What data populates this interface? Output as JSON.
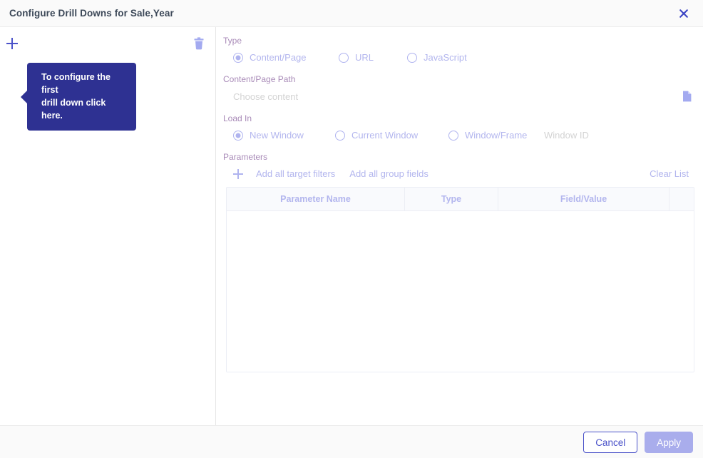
{
  "dialog": {
    "title": "Configure Drill Downs for Sale,Year",
    "close_icon": "close-icon"
  },
  "left_panel": {
    "add_icon": "plus-icon",
    "delete_icon": "trash-icon",
    "tooltip": {
      "line1": "To configure the first",
      "line2": "drill down click here."
    }
  },
  "type_section": {
    "label": "Type",
    "options": [
      {
        "label": "Content/Page",
        "selected": true
      },
      {
        "label": "URL",
        "selected": false
      },
      {
        "label": "JavaScript",
        "selected": false
      }
    ]
  },
  "content_path_section": {
    "label": "Content/Page Path",
    "placeholder": "Choose content",
    "value": "",
    "browse_icon": "document-icon"
  },
  "load_in_section": {
    "label": "Load In",
    "options": [
      {
        "label": "New Window",
        "selected": true
      },
      {
        "label": "Current Window",
        "selected": false
      },
      {
        "label": "Window/Frame",
        "selected": false
      }
    ],
    "window_id_placeholder": "Window ID",
    "window_id_value": ""
  },
  "parameters_section": {
    "label": "Parameters",
    "add_icon": "plus-icon",
    "add_target_filters": "Add all target filters",
    "add_group_fields": "Add all group fields",
    "clear_list": "Clear List",
    "table": {
      "columns": [
        "Parameter Name",
        "Type",
        "Field/Value",
        ""
      ],
      "rows": []
    }
  },
  "footer": {
    "cancel_label": "Cancel",
    "apply_label": "Apply"
  },
  "colors": {
    "accent": "#4a52c9",
    "tooltip_bg": "#2e3192",
    "disabled_text": "#b3b6ee",
    "label_text": "#a98bb8",
    "title_text": "#3c4858"
  }
}
